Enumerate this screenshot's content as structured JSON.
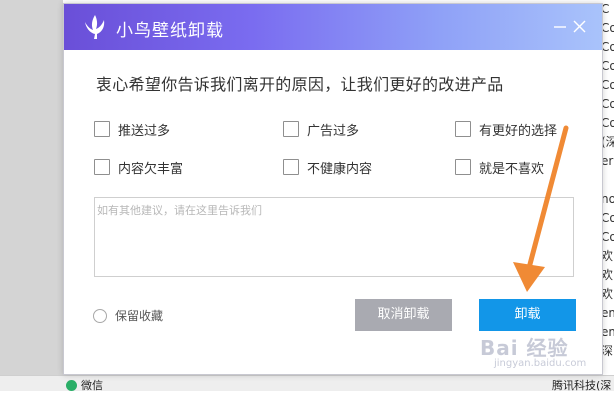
{
  "dialog": {
    "title": "小鸟壁纸卸载",
    "headline": "衷心希望你告诉我们离开的原因，让我们更好的改进产品",
    "options": [
      {
        "label": "推送过多"
      },
      {
        "label": "广告过多"
      },
      {
        "label": "有更好的选择"
      },
      {
        "label": "内容欠丰富"
      },
      {
        "label": "不健康内容"
      },
      {
        "label": "就是不喜欢"
      }
    ],
    "feedback_placeholder": "如有其他建议，请在这里告诉我们",
    "keep_favorites_label": "保留收藏",
    "cancel_label": "取消卸载",
    "confirm_label": "卸载"
  },
  "taskbar": {
    "left_item": "微信",
    "right_item": "腾讯科技(深"
  },
  "background_column": [
    "C",
    "Co",
    "Co",
    "Co",
    "Co",
    "Co",
    "Co",
    "(深",
    "er",
    "",
    "no",
    "Co",
    "Co",
    "欢",
    "欢",
    "欢",
    "em",
    "em",
    "深"
  ],
  "watermark": {
    "line1": "Bai 经验",
    "line2": "jingyan.baidu.com"
  },
  "colors": {
    "accent": "#1296e8",
    "cancel_bg": "#a9aab1",
    "arrow": "#f08a35",
    "title_gradient_start": "#6a4fd8",
    "title_gradient_end": "#a9c3fb"
  },
  "icons": {
    "logo": "bird-icon",
    "minimize": "minimize-icon",
    "close": "close-icon"
  }
}
